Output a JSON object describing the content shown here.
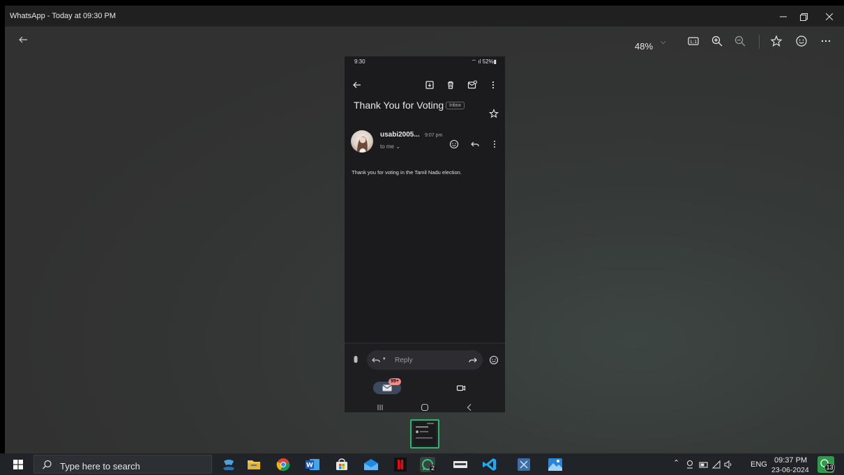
{
  "window": {
    "title": "WhatsApp - Today at 09:30 PM",
    "minimize_icon": "minimize-icon",
    "restore_icon": "restore-icon",
    "close_icon": "close-icon"
  },
  "toolbar": {
    "back_icon": "back-arrow-icon",
    "zoom": "48%",
    "actual_size_icon": "actual-size-icon",
    "zoom_in_icon": "zoom-in-icon",
    "zoom_out_icon": "zoom-out-icon",
    "favorite_icon": "star-icon",
    "feedback_icon": "smiley-icon",
    "more_icon": "more-icon"
  },
  "phone": {
    "status_time": "9:30",
    "status_battery": "52%",
    "subject": "Thank You for Voting",
    "label": "Inbox",
    "sender": "usabi2005...",
    "sent_time": "9:07 pm",
    "recipient": "to me",
    "body": "Thank you for voting in the Tamil Nadu election.",
    "reply_label": "Reply",
    "mail_badge": "99+"
  },
  "taskbar": {
    "search_placeholder": "Type here to search",
    "whatsapp_badge": "2",
    "language": "ENG",
    "time": "09:37 PM",
    "date": "23-06-2024",
    "notifications_count": "13"
  }
}
